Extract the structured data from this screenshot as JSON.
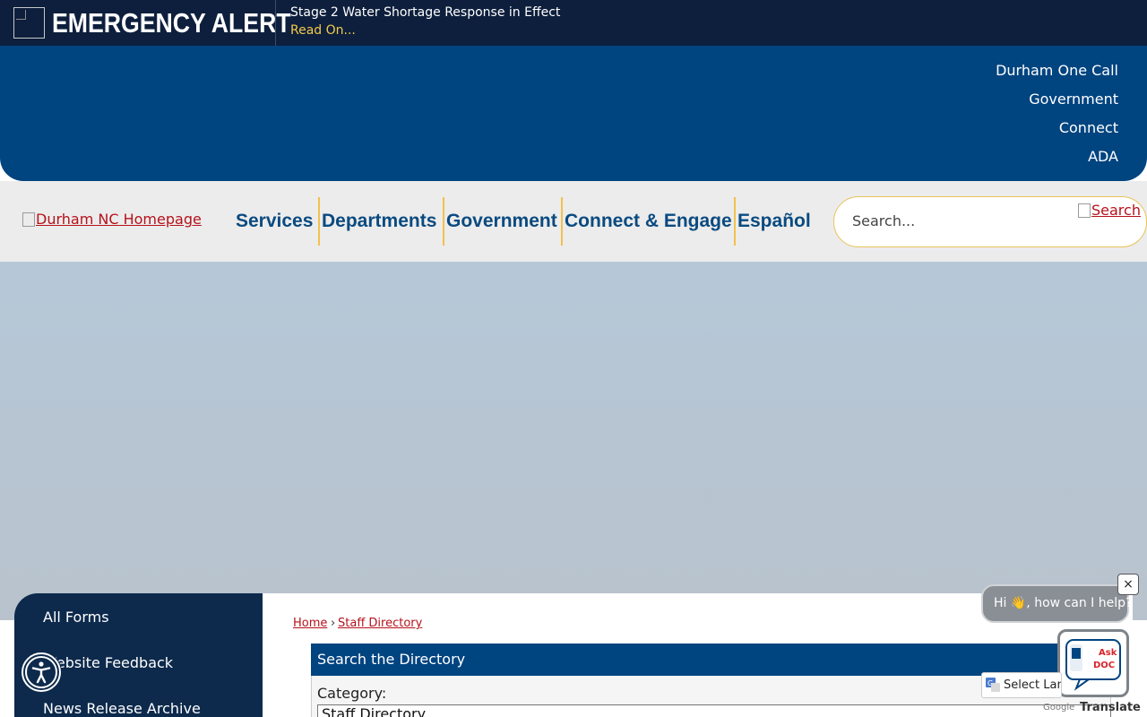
{
  "alert": {
    "title": "EMERGENCY ALERT",
    "message": "Stage 2 Water Shortage Response in Effect",
    "link": "Read On..."
  },
  "utility_nav": [
    "Durham One Call",
    "Government",
    "Connect",
    "ADA"
  ],
  "logo": {
    "alt": "Durham NC Homepage"
  },
  "main_nav": [
    "Services",
    "Departments",
    "Government",
    "Connect & Engage",
    "Español"
  ],
  "search": {
    "placeholder": "Search...",
    "button_alt": "Search"
  },
  "side_nav": [
    "All Forms",
    "Website Feedback",
    "News Release Archive"
  ],
  "breadcrumb": [
    "Home",
    "Staff Directory"
  ],
  "breadcrumb_sep": "›",
  "directory": {
    "header": "Search the Directory",
    "category_label": "Category:",
    "category_value": "Staff Directory"
  },
  "chat": {
    "greeting": "Hi 👋, how can I help?",
    "close": "×",
    "badge_line1": "Ask",
    "badge_line2": "DOC"
  },
  "translate": {
    "label": "Select Language",
    "powered_by": "Google",
    "action": "Translate"
  },
  "colors": {
    "alert_bg": "#0d1f3c",
    "header_blue": "#004480",
    "accent_gold": "#f2c14e",
    "link_red": "#b5121b",
    "sidenav_bg": "#0d2a4c"
  }
}
